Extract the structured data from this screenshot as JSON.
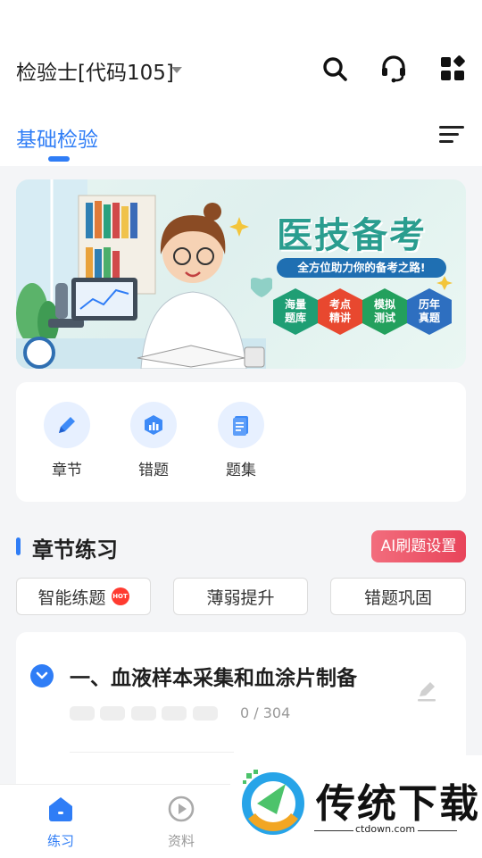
{
  "header": {
    "title": "检验士[代码105]",
    "active_tab": "基础检验"
  },
  "banner": {
    "title": "医技备考",
    "subtitle": "全方位助力你的备考之路!",
    "badges": [
      "海量\n题库",
      "考点\n精讲",
      "模拟\n测试",
      "历年\n真题"
    ],
    "badge_colors": [
      "#1f9e74",
      "#e8482f",
      "#23a05d",
      "#2e6fc0"
    ]
  },
  "tools": [
    {
      "label": "章节",
      "icon": "pencil-icon"
    },
    {
      "label": "错题",
      "icon": "chart-icon"
    },
    {
      "label": "题集",
      "icon": "document-icon"
    }
  ],
  "section": {
    "title": "章节练习",
    "ai_button": "AI刷题设置",
    "buttons": [
      "智能练题",
      "薄弱提升",
      "错题巩固"
    ],
    "hot_badge": "HOT"
  },
  "chapter": {
    "title": "一、血液样本采集和血涂片制备",
    "progress": "0 / 304"
  },
  "bottom_nav": [
    {
      "label": "练习",
      "icon": "home-icon",
      "active": true
    },
    {
      "label": "资料",
      "icon": "play-icon",
      "active": false
    }
  ],
  "watermark": {
    "text": "传统下载",
    "url": "ctdown.com"
  },
  "colors": {
    "accent": "#2f7df6",
    "ai_button": "#e8445a"
  }
}
